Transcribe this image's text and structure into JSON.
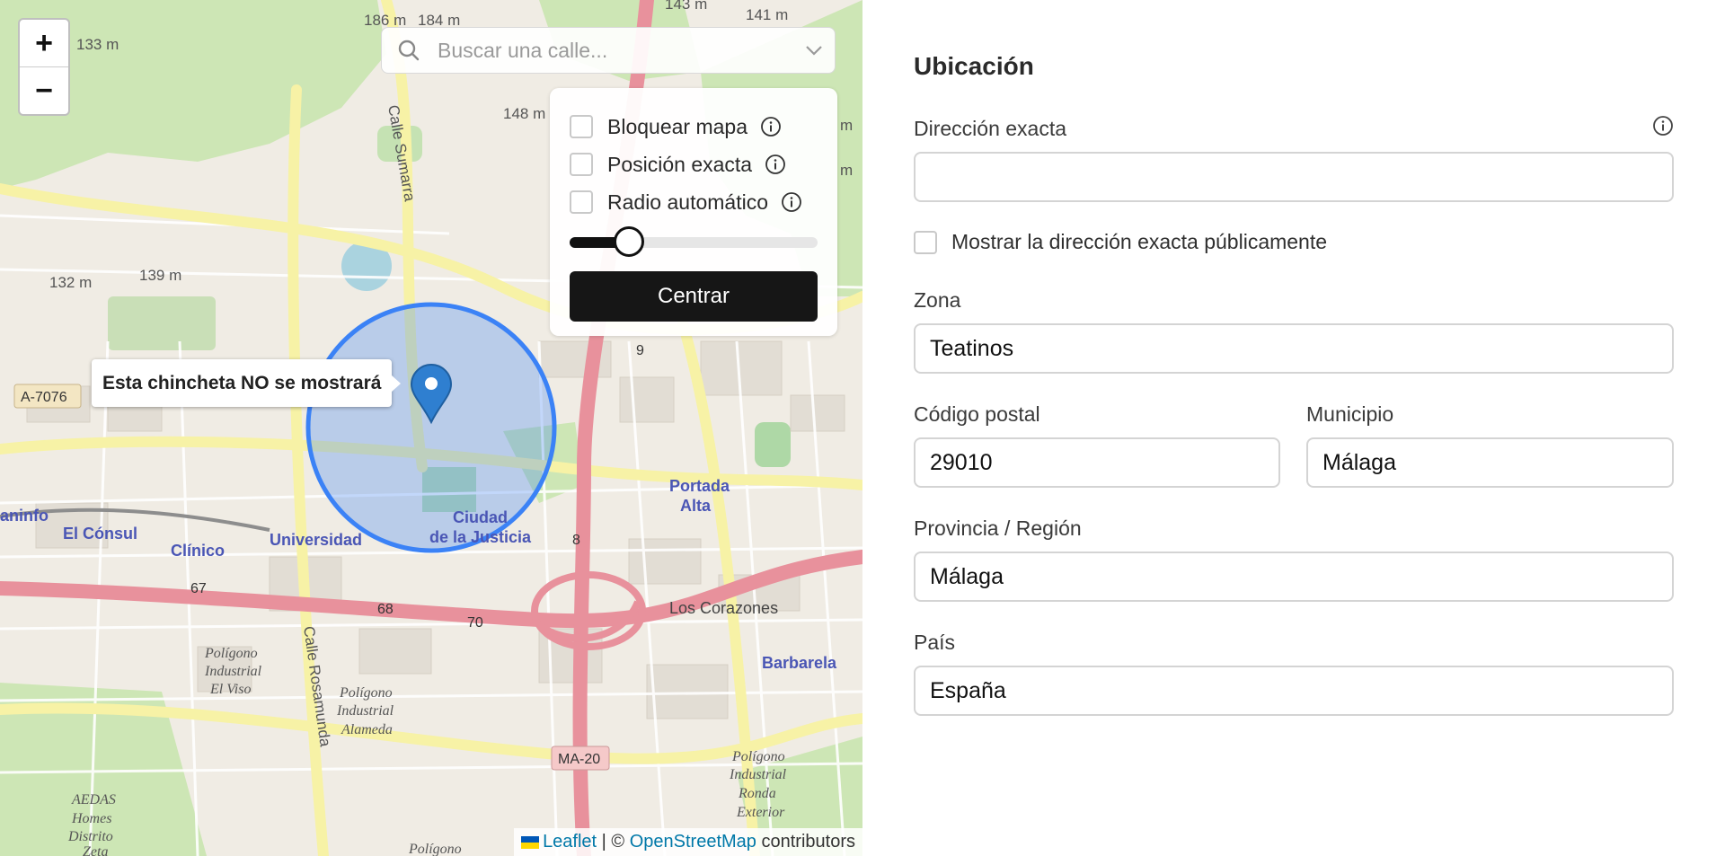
{
  "map": {
    "zoom_in": "+",
    "zoom_out": "−",
    "search_placeholder": "Buscar una calle...",
    "options": [
      {
        "label": "Bloquear mapa",
        "checked": false
      },
      {
        "label": "Posición exacta",
        "checked": false
      },
      {
        "label": "Radio automático",
        "checked": false
      }
    ],
    "radius_slider_fraction": 0.24,
    "center_button": "Centrar",
    "pin_tooltip": "Esta chincheta NO se mostrará",
    "attribution": {
      "leaflet": "Leaflet",
      "separator": " | © ",
      "osm": "OpenStreetMap",
      "suffix": " contributors"
    },
    "labels": {
      "l1": "186 m",
      "l2": "184 m",
      "l3": "143 m",
      "l4": "141 m",
      "l5": "133 m",
      "l6": "148 m",
      "l7": "139 m",
      "l8": "132 m",
      "l9": "A-7076",
      "l10": "Calle Sumarra",
      "l11": "Portada",
      "l12": "Alta",
      "l13": "Ciudad",
      "l14": "de la Justicia",
      "l15": "El Cónsul",
      "l16": "Clínico",
      "l17": "Universidad",
      "l18": "aninfo",
      "l19": "Los Corazones",
      "l20": "Barbarela",
      "l21": "MA-20",
      "l22": "Calle Rosamunda",
      "l23": "Polígono",
      "l24": "Industrial",
      "l25": "El Viso",
      "l26": "Polígono",
      "l27": "Industrial",
      "l28": "Alameda",
      "l29": "Polígono",
      "l30": "Industrial",
      "l31": "Ronda",
      "l32": "Exterior",
      "l33": "AEDAS",
      "l34": "Homes",
      "l35": "Distrito",
      "l36": "67",
      "l37": "68",
      "l38": "70",
      "l39": "8",
      "l40": "9",
      "l41": "Polígono",
      "l42": "Zeta",
      "l43": "m",
      "l44": "m"
    }
  },
  "form": {
    "title": "Ubicación",
    "address_label": "Dirección exacta",
    "address_value": "",
    "show_public_label": "Mostrar la dirección exacta públicamente",
    "show_public_checked": false,
    "zone_label": "Zona",
    "zone_value": "Teatinos",
    "postal_label": "Código postal",
    "postal_value": "29010",
    "municipality_label": "Municipio",
    "municipality_value": "Málaga",
    "province_label": "Provincia / Región",
    "province_value": "Málaga",
    "country_label": "País",
    "country_value": "España"
  },
  "colors": {
    "accent": "#161616",
    "circle": "#3b82f6",
    "pin": "#2f7fd0",
    "link": "#0078a8"
  }
}
